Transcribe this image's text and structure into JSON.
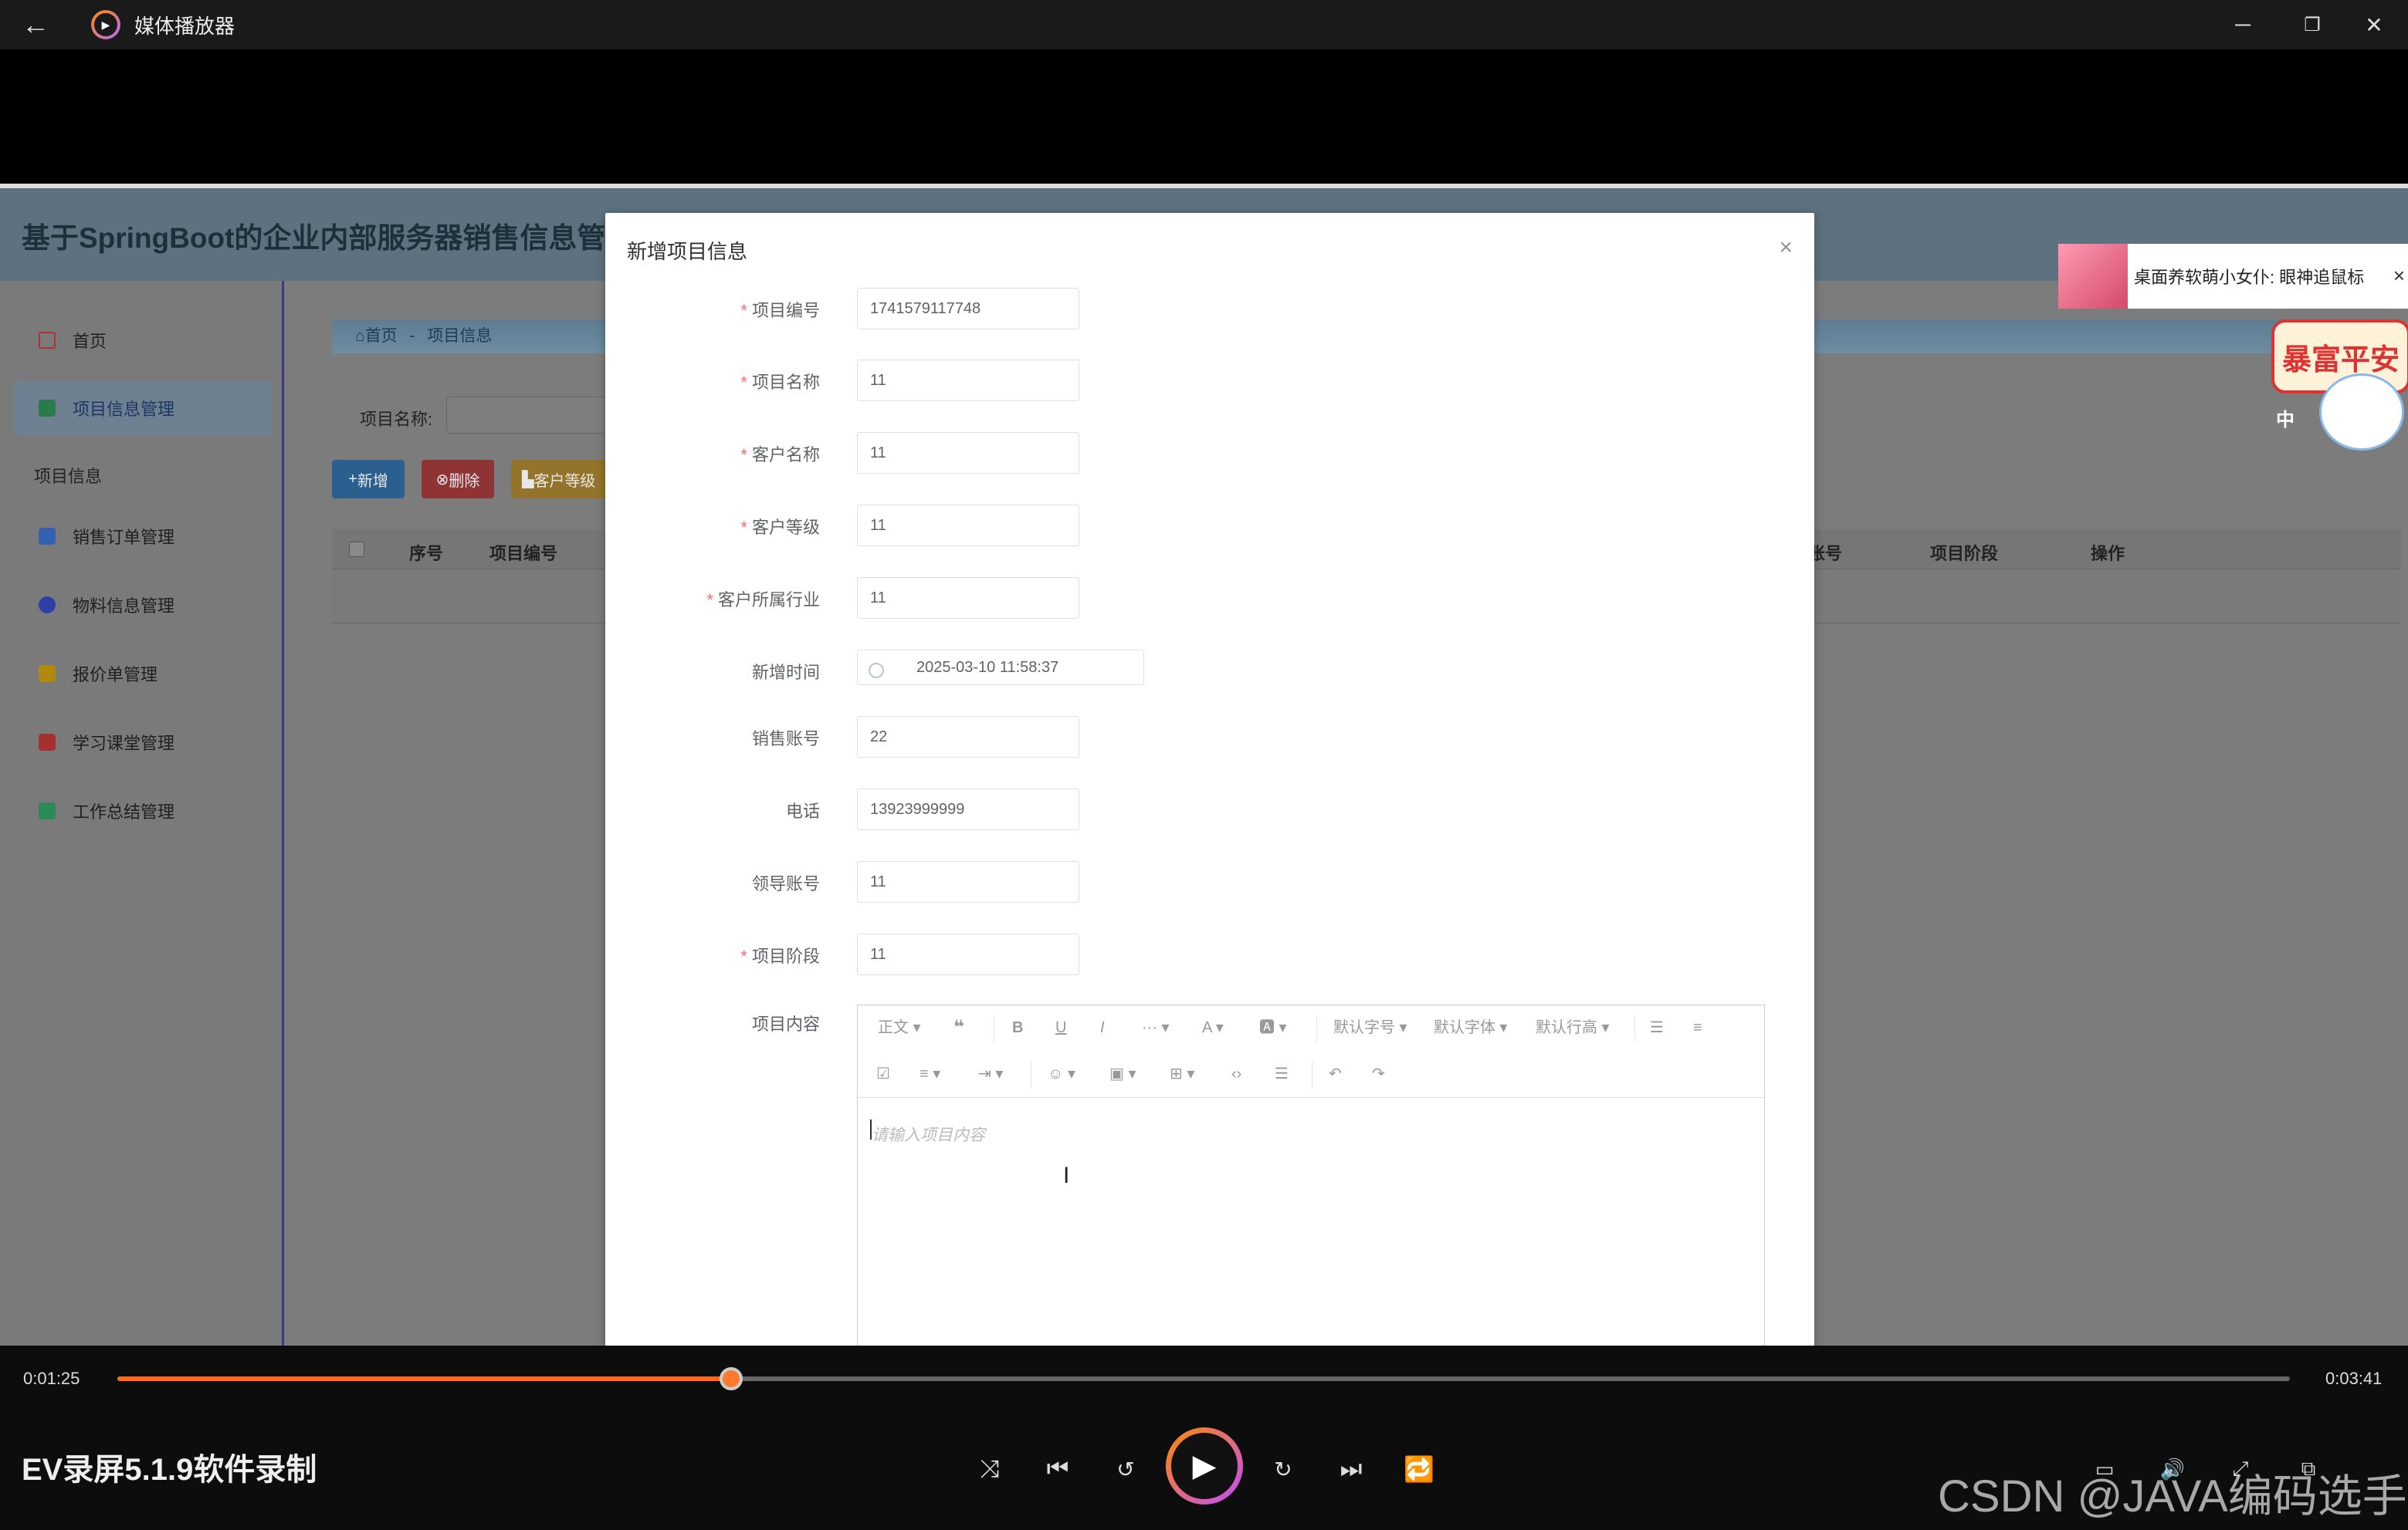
{
  "window": {
    "title": "媒体播放器",
    "back_icon": "←",
    "minimize_icon": "─",
    "maximize_icon": "❐",
    "close_icon": "✕"
  },
  "app": {
    "system_title": "基于SpringBoot的企业内部服务器销售信息管理",
    "sidebar": {
      "home": "首页",
      "project_mgmt": "项目信息管理",
      "group_label": "项目信息",
      "items": [
        "销售订单管理",
        "物料信息管理",
        "报价单管理",
        "学习课堂管理",
        "工作总结管理"
      ]
    },
    "breadcrumb": {
      "home": "首页",
      "sep": "-",
      "current": "项目信息"
    },
    "filter": {
      "label": "项目名称:"
    },
    "buttons": {
      "add": "新增",
      "delete": "删除",
      "customer_level": "客户等级"
    },
    "table_headers": [
      "序号",
      "项目编号",
      "账号",
      "项目阶段",
      "操作"
    ]
  },
  "modal": {
    "title": "新增项目信息",
    "close_icon": "×",
    "fields": [
      {
        "label": "项目编号",
        "required": true,
        "value": "1741579117748"
      },
      {
        "label": "项目名称",
        "required": true,
        "value": "11"
      },
      {
        "label": "客户名称",
        "required": true,
        "value": "11"
      },
      {
        "label": "客户等级",
        "required": true,
        "value": "11"
      },
      {
        "label": "客户所属行业",
        "required": true,
        "value": "11"
      },
      {
        "label": "新增时间",
        "required": false,
        "value": "2025-03-10 11:58:37"
      },
      {
        "label": "销售账号",
        "required": false,
        "value": "22"
      },
      {
        "label": "电话",
        "required": false,
        "value": "13923999999"
      },
      {
        "label": "领导账号",
        "required": false,
        "value": "11"
      },
      {
        "label": "项目阶段",
        "required": true,
        "value": "11"
      }
    ],
    "content_label": "项目内容",
    "editor": {
      "placeholder": "请输入项目内容",
      "toolbar": {
        "heading": "正文",
        "font_size": "默认字号",
        "font_family": "默认字体",
        "line_height": "默认行高"
      }
    }
  },
  "overlays": {
    "notify_text": "桌面养软萌小女仆: 眼神追鼠标",
    "badge_text": "暴富平安",
    "cat_label": "中"
  },
  "player": {
    "current_time": "0:01:25",
    "total_time": "0:03:41",
    "progress": 0.2826,
    "recording_name": "EV录屏5.1.9软件录制",
    "watermark": "CSDN @JAVA编码选手"
  }
}
